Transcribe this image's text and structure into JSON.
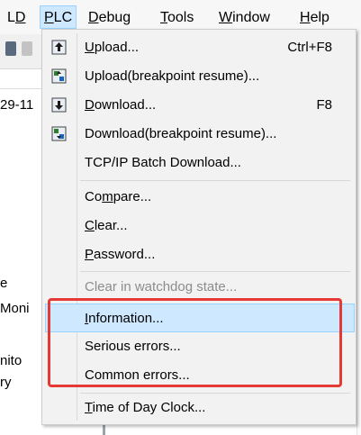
{
  "menubar": {
    "items": [
      {
        "pre": "L",
        "u": "D",
        "post": ""
      },
      {
        "pre": "",
        "u": "P",
        "post": "LC"
      },
      {
        "pre": "",
        "u": "D",
        "post": "ebug"
      },
      {
        "pre": "",
        "u": "T",
        "post": "ools"
      },
      {
        "pre": "",
        "u": "W",
        "post": "indow"
      },
      {
        "pre": "",
        "u": "H",
        "post": "elp"
      }
    ]
  },
  "background": {
    "lines": [
      "29-11",
      "e",
      "Moni",
      "nito",
      "ry"
    ]
  },
  "menu": {
    "upload": {
      "pre": "",
      "u": "U",
      "post": "pload...",
      "shortcut": "Ctrl+F8"
    },
    "upload_resume": {
      "label": "Upload(breakpoint resume)..."
    },
    "download": {
      "pre": "",
      "u": "D",
      "post": "ownload...",
      "shortcut": "F8"
    },
    "download_resume": {
      "label": "Download(breakpoint resume)..."
    },
    "tcpip": {
      "label": "TCP/IP Batch Download..."
    },
    "compare": {
      "pre": "Co",
      "u": "m",
      "post": "pare..."
    },
    "clear": {
      "pre": "",
      "u": "C",
      "post": "lear..."
    },
    "password": {
      "pre": "",
      "u": "P",
      "post": "assword..."
    },
    "clear_watchdog": {
      "label": "Clear in watchdog state..."
    },
    "information": {
      "pre": "",
      "u": "I",
      "post": "nformation..."
    },
    "serious_errors": {
      "label": "Serious errors..."
    },
    "common_errors": {
      "label": "Common errors..."
    },
    "clock": {
      "pre": "",
      "u": "T",
      "post": "ime of Day Clock..."
    }
  },
  "colors": {
    "hover_bg": "#cde8ff",
    "hover_border": "#99d1ff",
    "annotation_red": "#e53935",
    "disabled_text": "#8c8c8c"
  },
  "icons": {
    "upload": "upload-icon",
    "upload_resume": "upload-resume-icon",
    "download": "download-icon",
    "download_resume": "download-resume-icon"
  }
}
